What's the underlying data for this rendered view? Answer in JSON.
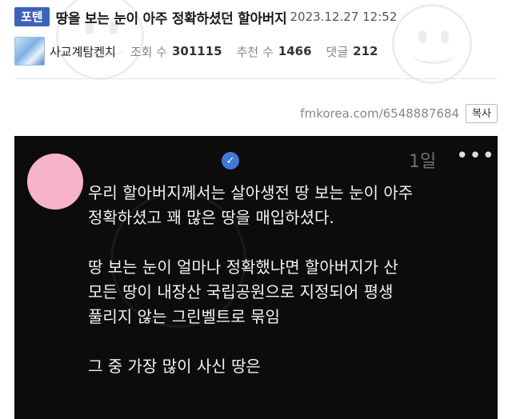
{
  "header": {
    "category": "포텐",
    "title": "땅을 보는 눈이 아주 정확하셨던 할아버지",
    "date": "2023.12.27 12:52"
  },
  "meta": {
    "author": "사교계탐켄치",
    "views_label": "조회 수",
    "views": "301115",
    "recommend_label": "추천 수",
    "recommend": "1466",
    "comments_label": "댓글",
    "comments": "212"
  },
  "link": {
    "url": "fmkorea.com/6548887684",
    "copy_label": "복사"
  },
  "card": {
    "time_ago": "1일",
    "more_icon": "more-dots-icon",
    "paragraphs": [
      [
        "우리 할아버지께서는 살아생전 땅 보는 눈이 아주",
        "정확하셨고 꽤 많은 땅을 매입하셨다."
      ],
      [
        "땅 보는 눈이 얼마나 정확했냐면 할아버지가 산",
        "모든 땅이 내장산 국립공원으로 지정되어 평생",
        "풀리지 않는 그린벨트로 묶임"
      ],
      [
        "그 중 가장 많이 사신 땅은"
      ]
    ]
  },
  "colors": {
    "category_badge": "#3d63b8",
    "card_background": "#0c0c0c",
    "card_avatar": "#f7b3c9",
    "verified_badge": "#3e7ad6"
  }
}
